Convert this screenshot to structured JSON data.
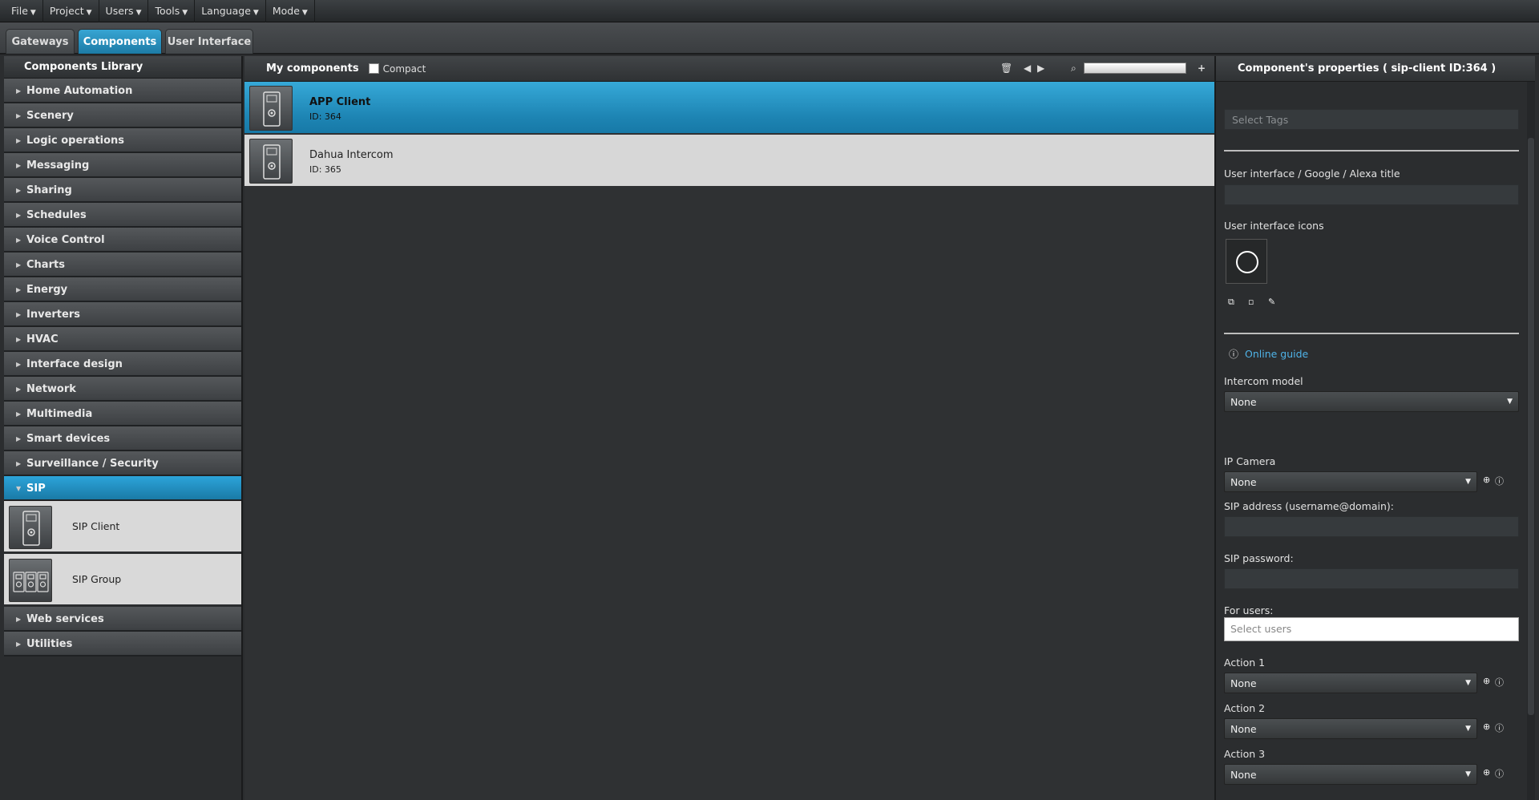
{
  "menubar": {
    "items": [
      "File",
      "Project",
      "Users",
      "Tools",
      "Language",
      "Mode"
    ]
  },
  "tabs": [
    {
      "label": "Gateways",
      "active": false
    },
    {
      "label": "Components",
      "active": true
    },
    {
      "label": "User Interface",
      "active": false
    }
  ],
  "library": {
    "title": "Components Library",
    "categories": [
      "Home Automation",
      "Scenery",
      "Logic operations",
      "Messaging",
      "Sharing",
      "Schedules",
      "Voice Control",
      "Charts",
      "Energy",
      "Inverters",
      "HVAC",
      "Interface design",
      "Network",
      "Multimedia",
      "Smart devices",
      "Surveillance / Security"
    ],
    "active_category": "SIP",
    "sip_items": [
      "SIP Client",
      "SIP Group"
    ],
    "after_categories": [
      "Web services",
      "Utilities"
    ]
  },
  "my_components": {
    "title": "My components",
    "compact_label": "Compact",
    "rows": [
      {
        "name": "APP Client",
        "id": "ID: 364",
        "selected": true
      },
      {
        "name": "Dahua Intercom",
        "id": "ID: 365",
        "selected": false
      }
    ]
  },
  "properties": {
    "title": "Component's properties ( sip-client ID:364 )",
    "tags_placeholder": "Select Tags",
    "ui_title_label": "User interface / Google / Alexa title",
    "ui_icons_label": "User interface icons",
    "online_guide": "Online guide",
    "intercom_model_label": "Intercom model",
    "intercom_model_value": "None",
    "ip_camera_label": "IP Camera",
    "ip_camera_value": "None",
    "sip_address_label": "SIP address (username@domain):",
    "sip_password_label": "SIP password:",
    "for_users_label": "For users:",
    "users_placeholder": "Select users",
    "actions": [
      {
        "label": "Action 1",
        "value": "None"
      },
      {
        "label": "Action 2",
        "value": "None"
      },
      {
        "label": "Action 3",
        "value": "None"
      }
    ]
  },
  "colors": {
    "accent": "#2196c9",
    "panel": "#2b2d2f",
    "row_light": "#d7d7d7"
  }
}
